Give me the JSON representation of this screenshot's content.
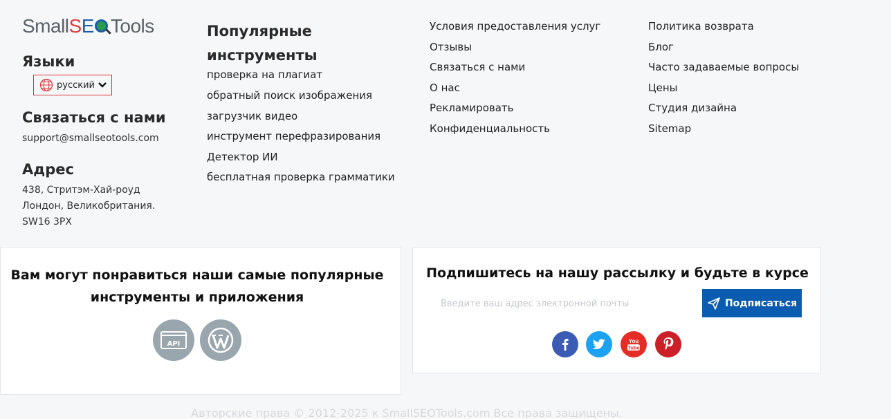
{
  "logo": {
    "part1": "Small",
    "part_s": "S",
    "part_e": "E",
    "part2": "Tools"
  },
  "languages": {
    "heading": "Языки",
    "selected": "русский"
  },
  "contact": {
    "heading": "Связаться с нами",
    "email": "support@smallseotools.com"
  },
  "address": {
    "heading": "Адрес",
    "lines": [
      "438, Стритэм-Хай-роуд",
      "Лондон, Великобритания.",
      "SW16 3PX"
    ]
  },
  "popular": {
    "heading": "Популярные инструменты",
    "links": [
      "проверка на плагиат",
      "обратный поиск изображения",
      "загрузчик видео",
      "инструмент перефразирования",
      "Детектор ИИ",
      "бесплатная проверка грамматики"
    ]
  },
  "company_links": [
    "Условия предоставления услуг",
    "Отзывы",
    "Связаться с нами",
    "О нас",
    "Рекламировать",
    "Конфиденциальность"
  ],
  "more_links": [
    "Политика возврата",
    "Блог",
    "Часто задаваемые вопросы",
    "Цены",
    "Студия дизайна",
    "Sitemap"
  ],
  "apps_box": {
    "title": "Вам могут понравиться наши самые популярные инструменты и приложения",
    "api_label": "API"
  },
  "newsletter": {
    "title": "Подпишитесь на нашу рассылку и будьте в курсе",
    "placeholder": "Введите ваш адрес электронной почты",
    "button": "Подписаться",
    "social": [
      "facebook-icon",
      "twitter-icon",
      "youtube-icon",
      "pinterest-icon"
    ],
    "youtube_text": "You Tube"
  },
  "copyright": "Авторские права © 2012-2025 к SmallSEOTools.com Все права защищены.",
  "colors": {
    "accent_blue": "#0a5cb0",
    "logo_red": "#e03a3e",
    "facebook": "#3b5bb5",
    "twitter": "#1da1f2",
    "youtube": "#e52d27",
    "pinterest": "#cb2027"
  }
}
